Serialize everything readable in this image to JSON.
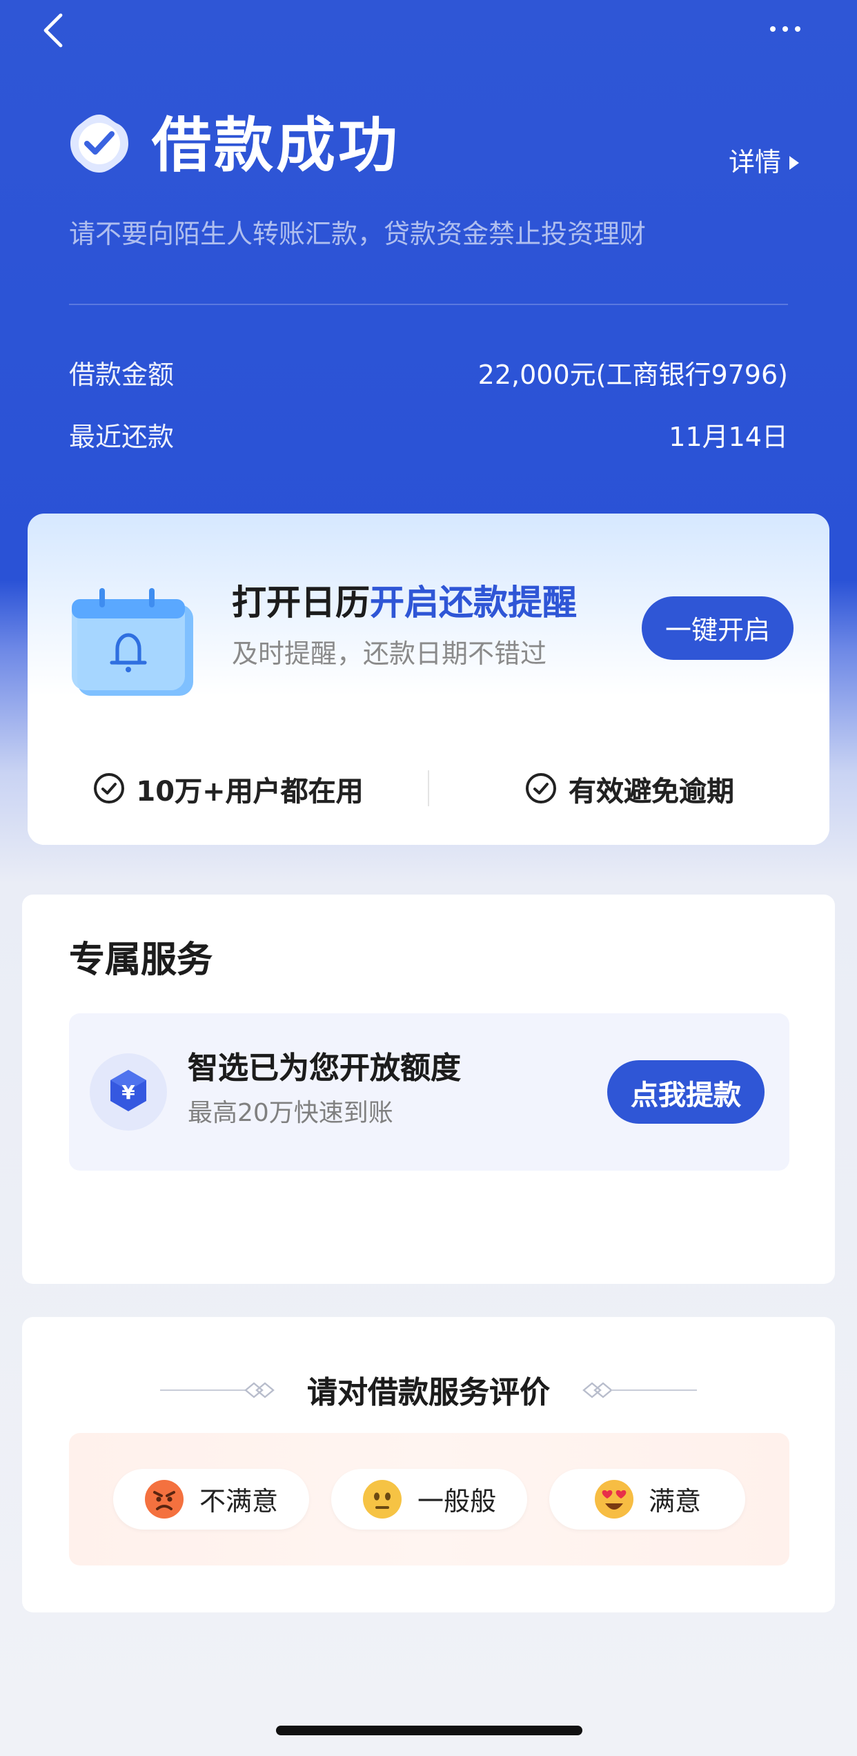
{
  "header": {
    "title": "借款成功",
    "detail_link": "详情",
    "warning": "请不要向陌生人转账汇款，贷款资金禁止投资理财"
  },
  "loan_info": {
    "amount_label": "借款金额",
    "amount_value": "22,000元(工商银行9796)",
    "repay_label": "最近还款",
    "repay_value": "11月14日"
  },
  "calendar_card": {
    "title_prefix": "打开日历",
    "title_highlight": "开启还款提醒",
    "subtitle": "及时提醒，还款日期不错过",
    "button": "一键开启",
    "feature_1": "10万+用户都在用",
    "feature_2": "有效避免逾期"
  },
  "service_card": {
    "title": "专属服务",
    "headline": "智选已为您开放额度",
    "subline": "最高20万快速到账",
    "button": "点我提款",
    "icon_glyph": "¥"
  },
  "rating_card": {
    "title": "请对借款服务评价",
    "options": [
      "不满意",
      "一般般",
      "满意"
    ]
  },
  "colors": {
    "brand_blue": "#2f56d6",
    "page_bg": "#f0f2f7"
  }
}
